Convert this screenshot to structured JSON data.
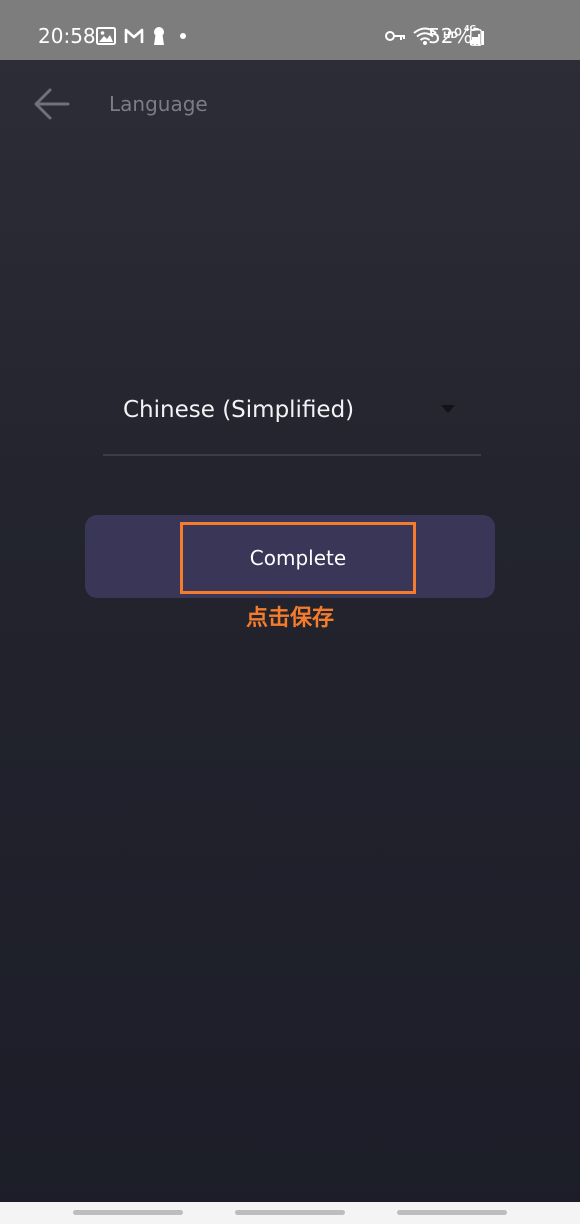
{
  "status_bar": {
    "time": "20:58",
    "left_icons": [
      "image-icon",
      "gmail-icon",
      "keyhole-icon",
      "dot-icon"
    ],
    "right_icons": [
      "vpn-key-icon",
      "wifi-icon",
      "hd-icon",
      "signal-4g-icon",
      "battery-icon"
    ],
    "hd_label": "HD",
    "network_label": "4G",
    "battery": "52%"
  },
  "app_bar": {
    "title": "Language"
  },
  "language_select": {
    "value": "Chinese (Simplified)"
  },
  "complete_button": {
    "label": "Complete"
  },
  "annotation": {
    "text": "点击保存",
    "color": "#f47c2c"
  },
  "colors": {
    "background_top": "#2e2e38",
    "background_bottom": "#1c1d28",
    "button": "#3a3657",
    "status_bar": "#7d7d7d"
  }
}
